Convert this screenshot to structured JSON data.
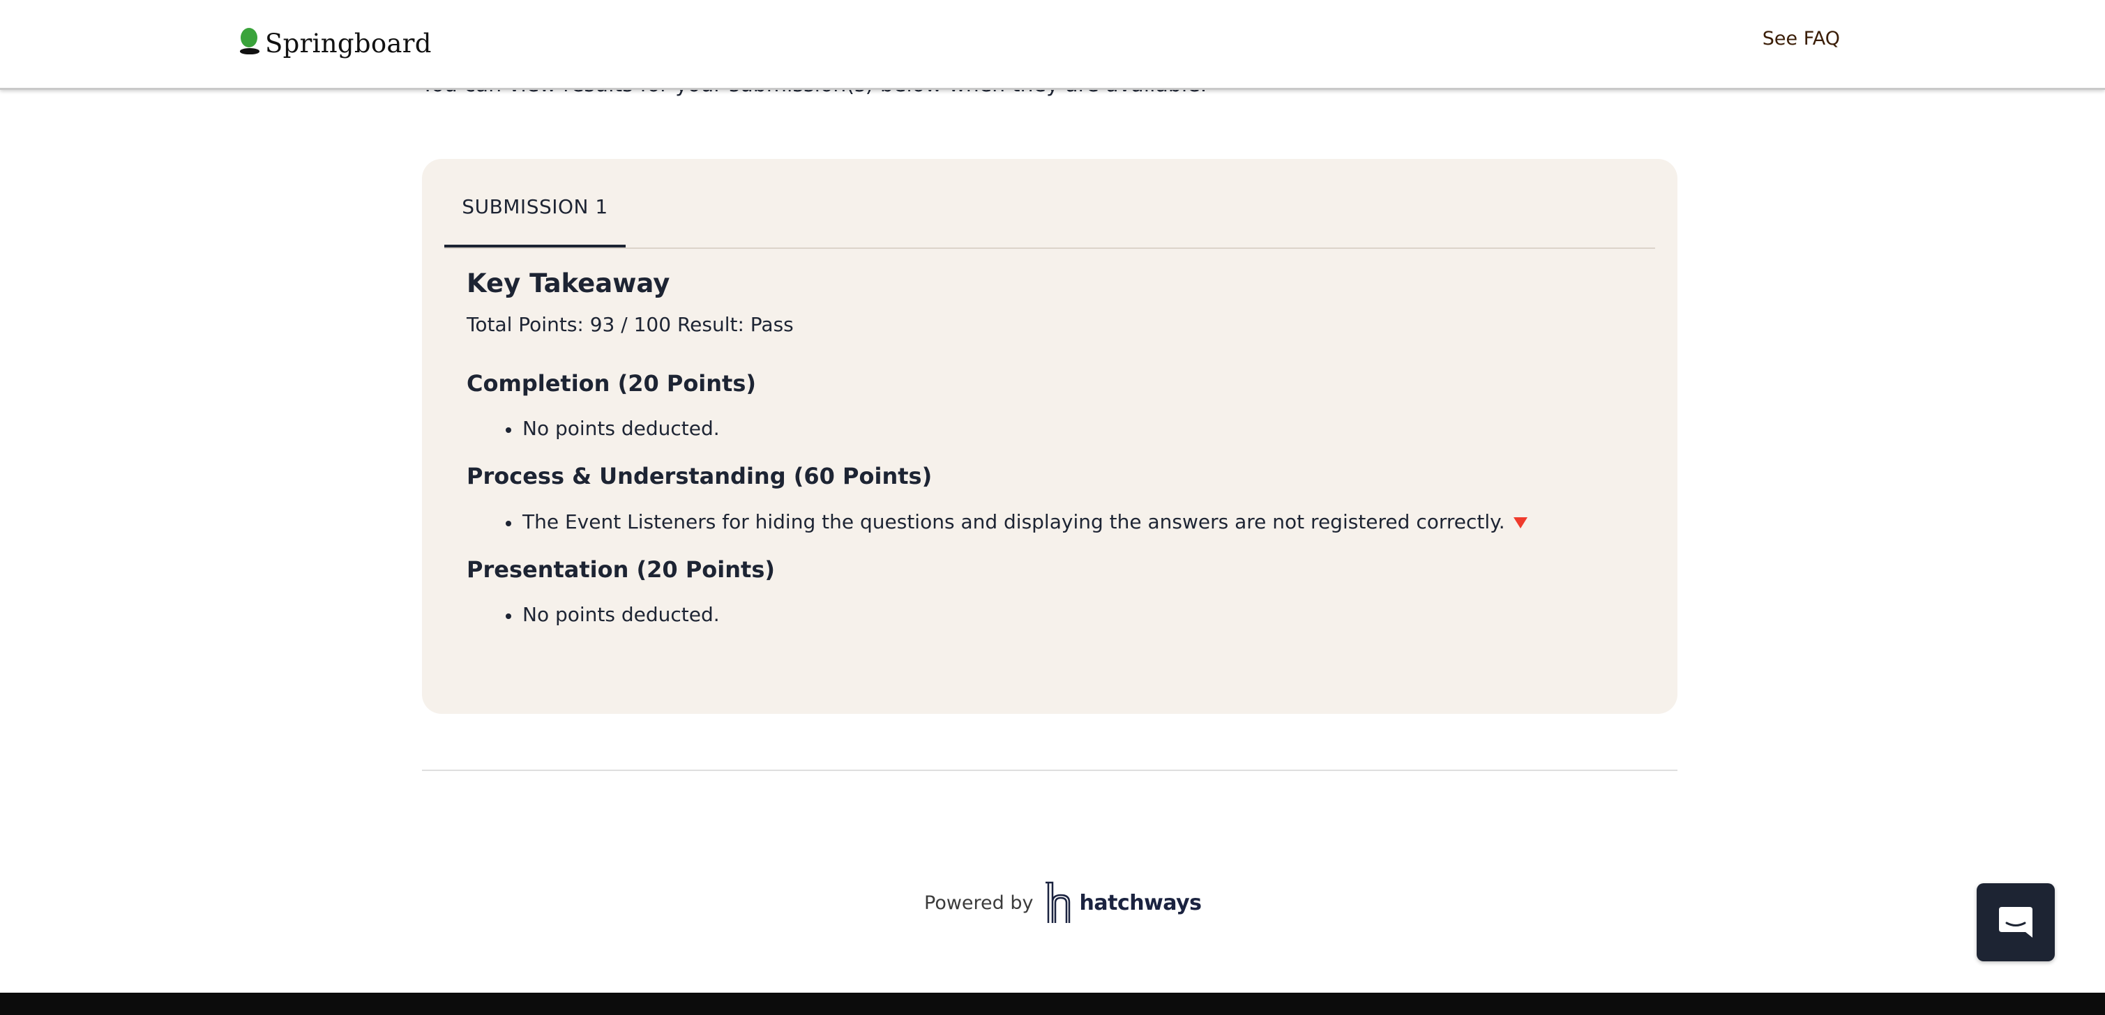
{
  "header": {
    "brand_name": "Springboard",
    "faq_label": "See FAQ"
  },
  "intro_text": "You can view results for your submission(s) below when they are available.",
  "submission": {
    "tab_label": "SUBMISSION 1",
    "title": "Key Takeaway",
    "summary": "Total Points: 93 / 100 Result: Pass",
    "sections": [
      {
        "heading": "Completion (20 Points)",
        "items": [
          "No points deducted."
        ]
      },
      {
        "heading": "Process & Understanding (60 Points)",
        "items": [
          "The Event Listeners for hiding the questions and displaying the answers are not registered correctly."
        ]
      },
      {
        "heading": "Presentation (20 Points)",
        "items": [
          "No points deducted."
        ]
      }
    ]
  },
  "footer": {
    "powered_by": "Powered by",
    "partner_name": "hatchways"
  },
  "icons": {
    "brand": "springboard-logo-icon",
    "deduction_marker": "red-triangle-down-icon",
    "partner": "hatchways-logo-icon",
    "chat": "chat-bubble-icon"
  },
  "colors": {
    "brand_green": "#3aa33b",
    "card_background": "#f6f1eb",
    "text_dark": "#1d2433",
    "faq_link": "#3a1d06",
    "deduction_marker": "#ef3b2d"
  }
}
